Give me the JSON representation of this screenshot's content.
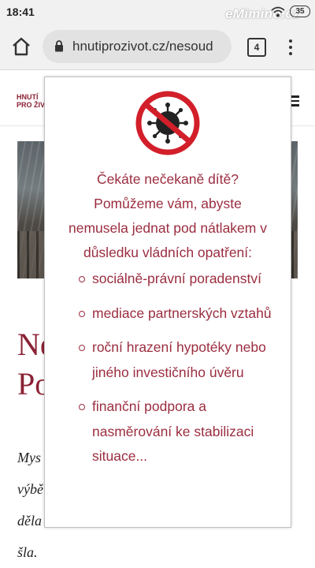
{
  "status_bar": {
    "time": "18:41",
    "watermark": "eMimino.cz",
    "battery": "35"
  },
  "browser": {
    "url": "hnutiprozivot.cz/nesoud",
    "tab_count": "4"
  },
  "site": {
    "logo_line1": "HNUTÍ",
    "logo_line2": "PRO ŽIV",
    "heading_line1": "Ne",
    "heading_line2": "Po",
    "paragraph_line1": "Mys",
    "paragraph_line2": "výbě",
    "paragraph_line3": "děla",
    "paragraph_line4": "šla."
  },
  "popup": {
    "icon": "no-coronavirus-icon",
    "lead_line1": "Čekáte nečekaně dítě?",
    "lead_line2": "Pomůžeme vám, abyste",
    "lead_line3": "nemusela jednat pod nátlakem v",
    "lead_line4": "důsledku vládních opatření:",
    "items": [
      "sociálně-právní poradenství",
      "mediace partnerských vztahů",
      "roční hrazení hypotéky nebo jiného investičního úvěru",
      "finanční podpora a nasměrování ke stabilizaci situace..."
    ]
  },
  "colors": {
    "accent": "#9b2d3f",
    "brand": "#8b2235",
    "icon_red": "#d21f2a"
  }
}
